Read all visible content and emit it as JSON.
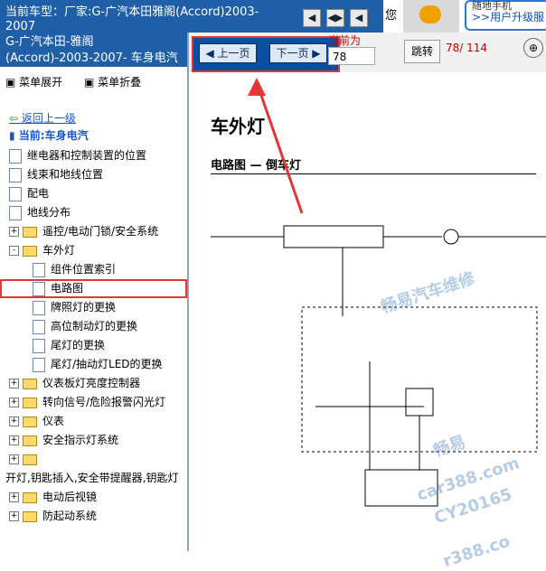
{
  "topbar": {
    "car_model": "当前车型：厂家:G-广汽本田雅阁(Accord)2003-2007",
    "nav_buttons": [
      "◀",
      "◀▶",
      "◀"
    ],
    "char": "您",
    "helper_line1": "随地手机",
    "helper_link": ">>用户升级服"
  },
  "sidebar": {
    "header": "G-广汽本田-雅阁 (Accord)-2003-2007- 车身电汽",
    "menu_expand": "菜单展开",
    "menu_collapse": "菜单折叠",
    "back": "返回上一级",
    "current": "当前:车身电汽",
    "tree": [
      {
        "label": "继电器和控制装置的位置",
        "type": "doc"
      },
      {
        "label": "线束和地线位置",
        "type": "doc"
      },
      {
        "label": "配电",
        "type": "doc"
      },
      {
        "label": "地线分布",
        "type": "doc"
      },
      {
        "label": "遥控/电动门锁/安全系统",
        "type": "folder",
        "pm": "+"
      },
      {
        "label": "车外灯",
        "type": "folder",
        "pm": "-"
      },
      {
        "label": "组件位置索引",
        "type": "doc"
      },
      {
        "label": "电路图",
        "type": "doc",
        "selected": true
      },
      {
        "label": "牌照灯的更换",
        "type": "doc"
      },
      {
        "label": "高位制动灯的更换",
        "type": "doc"
      },
      {
        "label": "尾灯的更换",
        "type": "doc"
      },
      {
        "label": "尾灯/抽动灯LED的更换",
        "type": "doc"
      },
      {
        "label": "仪表板灯亮度控制器",
        "type": "folder",
        "pm": "+"
      },
      {
        "label": "转向信号/危险报警闪光灯",
        "type": "folder",
        "pm": "+"
      },
      {
        "label": "仪表",
        "type": "folder",
        "pm": "+"
      },
      {
        "label": "安全指示灯系统",
        "type": "folder",
        "pm": "+"
      },
      {
        "label": "",
        "type": "folder",
        "pm": "+"
      },
      {
        "label": "开灯,钥匙插入,安全带提醒器,钥匙灯",
        "type": "text"
      },
      {
        "label": "电动后视镜",
        "type": "folder",
        "pm": "+"
      },
      {
        "label": "防起动系统",
        "type": "folder",
        "pm": "+"
      }
    ]
  },
  "viewer": {
    "prev_page": "上一页",
    "next_page": "下一页",
    "current_page_label": "当前为",
    "current_page": "78",
    "jump_label": "跳转",
    "page_count": "78/ 114",
    "zoom_icon": "⊕",
    "doc_title": "车外灯",
    "doc_subtitle": "电路图 — 倒车灯",
    "watermarks": [
      "畅易汽车维修",
      "畅易",
      "car388.com",
      "CY20165",
      "r388.co"
    ]
  }
}
